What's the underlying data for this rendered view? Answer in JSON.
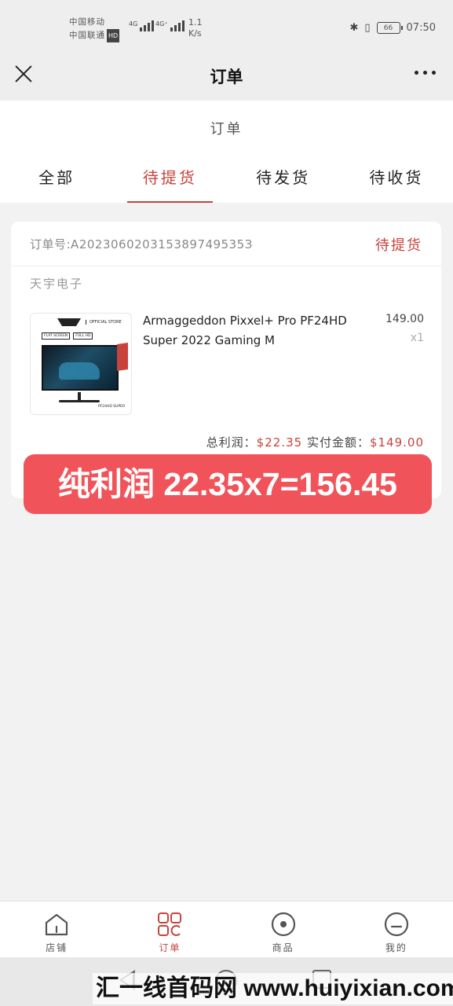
{
  "status_bar": {
    "carrier_1": "中国移动",
    "carrier_2": "中国联通",
    "hd_badge": "HD",
    "signal_1_label": "4G",
    "signal_2_label": "4G⁺",
    "speed_value": "1.1",
    "speed_unit": "K/s",
    "battery": "66",
    "time": "07:50"
  },
  "nav": {
    "title": "订单"
  },
  "page": {
    "subtitle": "订单"
  },
  "tabs": [
    {
      "label": "全部",
      "active": false
    },
    {
      "label": "待提货",
      "active": true
    },
    {
      "label": "待发货",
      "active": false
    },
    {
      "label": "待收货",
      "active": false
    }
  ],
  "order": {
    "order_number": "订单号:A202306020315389749535З",
    "status": "待提货",
    "store_name": "天宇电子",
    "product": {
      "name": "Armaggeddon Pixxel+ Pro PF24HD Super 2022 Gaming M",
      "price": "149.00",
      "quantity": "x1",
      "image_brand": "OFFICIAL STORE",
      "image_badge_1": "FLAT SCREEN",
      "image_badge_2": "FULL HD",
      "image_model": "PF24HD SUPER"
    },
    "summary": {
      "profit_label": "总利润：",
      "profit_value": "$22.35",
      "paid_label": "实付金额：",
      "paid_value": "$149.00"
    }
  },
  "banner": {
    "text": "纯利润 22.35x7=156.45"
  },
  "bottom_nav": [
    {
      "label": "店铺",
      "icon": "store-icon",
      "active": false
    },
    {
      "label": "订单",
      "icon": "order-grid-icon",
      "active": true
    },
    {
      "label": "商品",
      "icon": "product-circle-icon",
      "active": false
    },
    {
      "label": "我的",
      "icon": "profile-face-icon",
      "active": false
    }
  ],
  "watermark": {
    "text": "汇一线首码网 www.huiyixian.com"
  },
  "colors": {
    "accent": "#c8433c",
    "banner": "#f1535a",
    "page_bg": "#f2f2f2"
  }
}
